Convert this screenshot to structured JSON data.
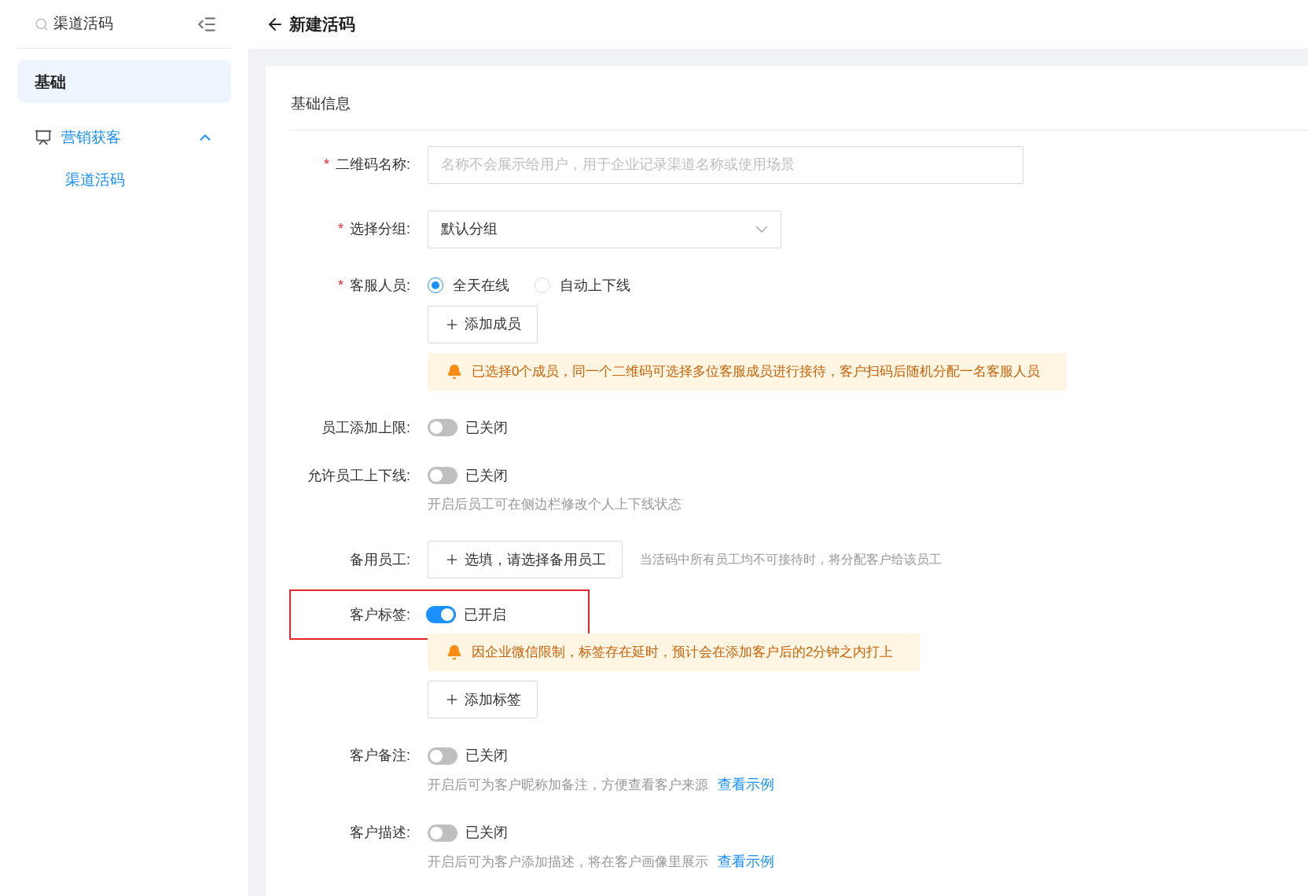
{
  "sidebar": {
    "search": {
      "value": "渠道活码"
    },
    "items": [
      {
        "label": "基础",
        "selected": true
      }
    ],
    "groups": [
      {
        "label": "营销获客",
        "expanded": true,
        "children": [
          {
            "label": "渠道活码",
            "selected": true
          }
        ]
      }
    ]
  },
  "header": {
    "title": "新建活码"
  },
  "form": {
    "section_title": "基础信息",
    "fields": [
      {
        "kind": "input",
        "label": "二维码名称:",
        "required_mark": "*",
        "placeholder": "名称不会展示给用户，用于企业记录渠道名称或使用场景"
      },
      {
        "kind": "select",
        "label": "选择分组:",
        "required_mark": "*",
        "value": "默认分组"
      },
      {
        "kind": "radio",
        "label": "客服人员:",
        "required_mark": "*",
        "options": [
          {
            "label": "全天在线",
            "selected": true
          },
          {
            "label": "自动上下线",
            "selected": false
          }
        ],
        "button": "添加成员",
        "alert": "已选择0个成员，同一个二维码可选择多位客服成员进行接待，客户扫码后随机分配一名客服人员"
      },
      {
        "kind": "switch",
        "label": "员工添加上限:",
        "on": false,
        "status": "已关闭"
      },
      {
        "kind": "switch",
        "label": "允许员工上下线:",
        "on": false,
        "status": "已关闭",
        "hint": "开启后员工可在侧边栏修改个人上下线状态"
      },
      {
        "kind": "button",
        "label": "备用员工:",
        "button": "选填，请选择备用员工",
        "hint": "当活码中所有员工均不可接待时，将分配客户给该员工"
      },
      {
        "kind": "switch",
        "label": "客户标签:",
        "highlighted": true,
        "on": true,
        "status": "已开启",
        "alert": "因企业微信限制，标签存在延时，预计会在添加客户后的2分钟之内打上",
        "button": "添加标签"
      },
      {
        "kind": "switch",
        "label": "客户备注:",
        "on": false,
        "status": "已关闭",
        "hint": "开启后可为客户昵称加备注，方便查看客户来源",
        "link": "查看示例"
      },
      {
        "kind": "switch",
        "label": "客户描述:",
        "on": false,
        "status": "已关闭",
        "hint": "开启后可为客户添加描述，将在客户画像里展示",
        "link": "查看示例"
      }
    ]
  }
}
